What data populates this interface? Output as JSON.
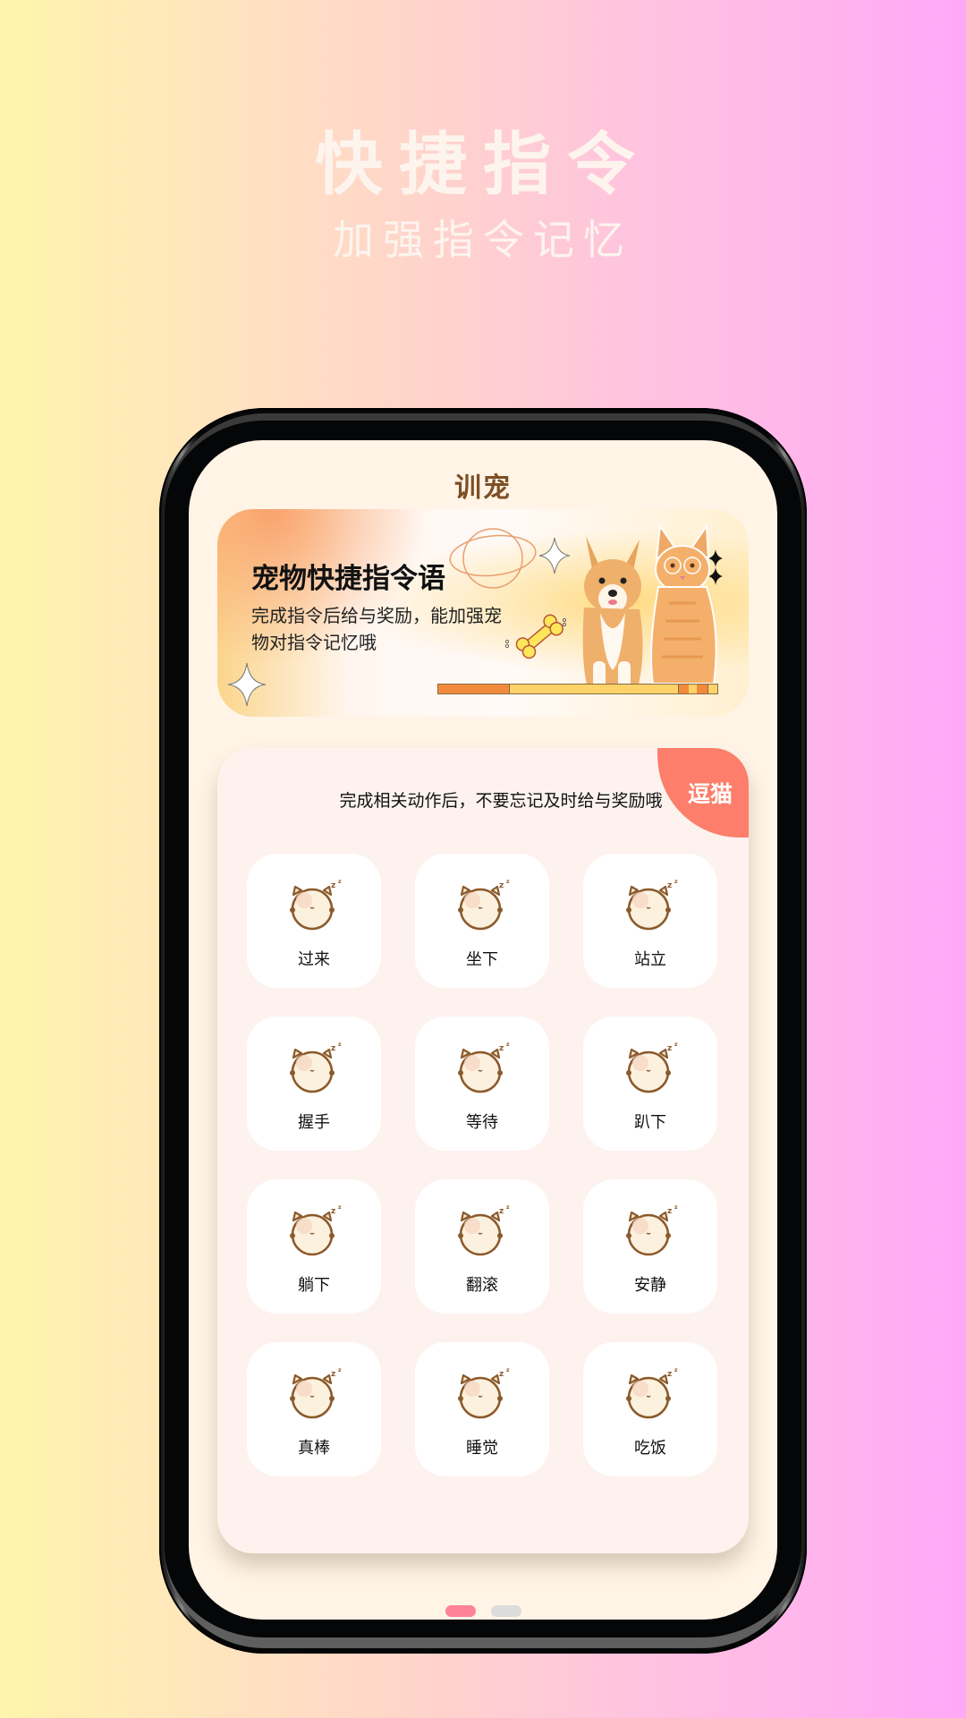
{
  "promo": {
    "title": "快捷指令",
    "subtitle": "加强指令记忆"
  },
  "app": {
    "title": "训宠"
  },
  "banner": {
    "title": "宠物快捷指令语",
    "description": "完成指令后给与奖励，能加强宠物对指令记忆哦",
    "shelf_colors": [
      "#f18a3c",
      "#fdd268",
      "#f18a3c",
      "#fdd268",
      "#f18a3c",
      "#fdd268"
    ]
  },
  "commands_panel": {
    "hint": "完成相关动作后，不要忘记及时给与奖励哦",
    "tag_label": "逗猫",
    "tag_color": "#fd7e6b",
    "items": [
      {
        "label": "过来",
        "icon": "sleeping-pet-icon"
      },
      {
        "label": "坐下",
        "icon": "sleeping-pet-icon"
      },
      {
        "label": "站立",
        "icon": "sleeping-pet-icon"
      },
      {
        "label": "握手",
        "icon": "sleeping-pet-icon"
      },
      {
        "label": "等待",
        "icon": "sleeping-pet-icon"
      },
      {
        "label": "趴下",
        "icon": "sleeping-pet-icon"
      },
      {
        "label": "躺下",
        "icon": "sleeping-pet-icon"
      },
      {
        "label": "翻滚",
        "icon": "sleeping-pet-icon"
      },
      {
        "label": "安静",
        "icon": "sleeping-pet-icon"
      },
      {
        "label": "真棒",
        "icon": "sleeping-pet-icon"
      },
      {
        "label": "睡觉",
        "icon": "sleeping-pet-icon"
      },
      {
        "label": "吃饭",
        "icon": "sleeping-pet-icon"
      }
    ]
  },
  "pager": {
    "pages": 2,
    "current": 1,
    "active_color": "#fe8399",
    "inactive_color": "#dcdcdc"
  }
}
